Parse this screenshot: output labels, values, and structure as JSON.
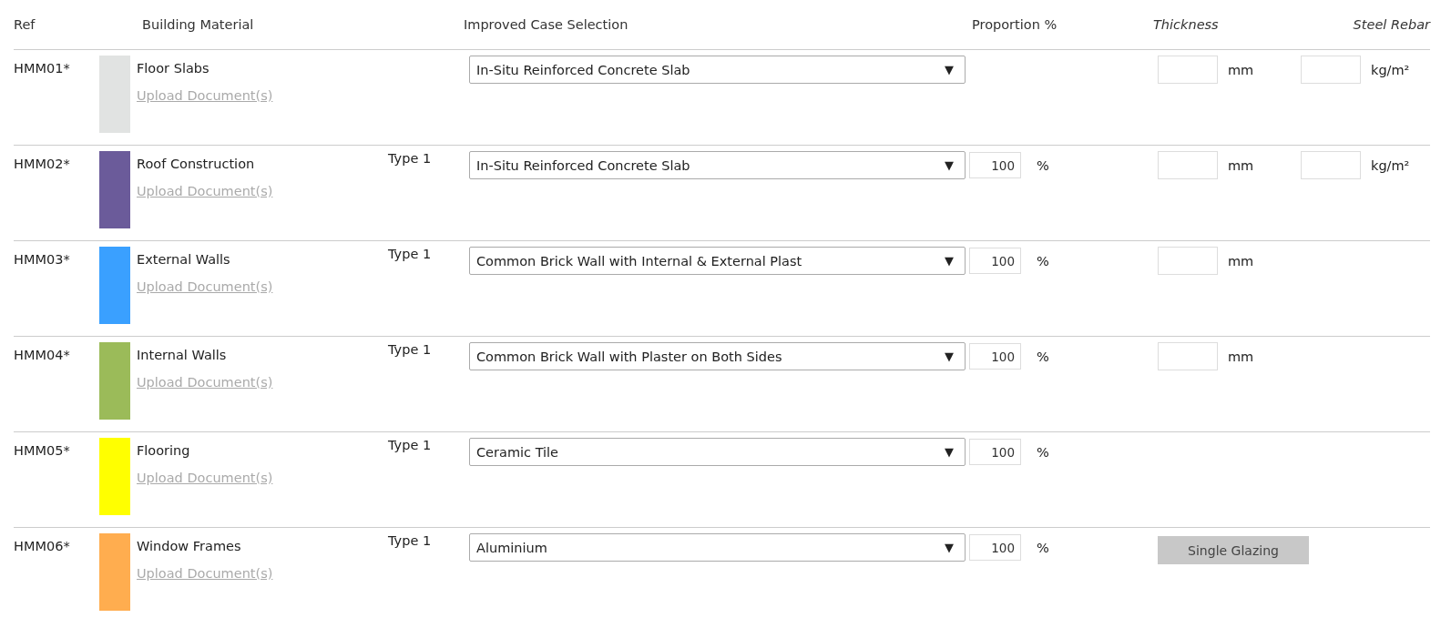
{
  "columns": {
    "ref": "Ref",
    "material": "Building Material",
    "selection": "Improved Case Selection",
    "proportion": "Proportion %",
    "thickness": "Thickness",
    "rebar": "Steel Rebar"
  },
  "rows": [
    {
      "ref": "HMM01*",
      "color": "#e1e3e2",
      "name": "Floor Slabs",
      "upload": "Upload Document(s)",
      "selection": "In-Situ Reinforced Concrete Slab",
      "arrow": "▼",
      "thickness_unit": "mm",
      "rebar_unit": "kg/m²"
    },
    {
      "ref": "HMM02*",
      "color": "#6b5b9a",
      "name": "Roof Construction",
      "upload": "Upload Document(s)",
      "type": "Type 1",
      "selection": "In-Situ Reinforced Concrete Slab",
      "arrow": "▼",
      "proportion": "100",
      "proportion_unit": "%",
      "thickness_unit": "mm",
      "rebar_unit": "kg/m²"
    },
    {
      "ref": "HMM03*",
      "color": "#3aa0ff",
      "name": "External Walls",
      "upload": "Upload Document(s)",
      "type": "Type 1",
      "selection": "Common Brick Wall with Internal & External Plast",
      "arrow": "▼",
      "proportion": "100",
      "proportion_unit": "%",
      "thickness_unit": "mm"
    },
    {
      "ref": "HMM04*",
      "color": "#9bbb59",
      "name": "Internal Walls",
      "upload": "Upload Document(s)",
      "type": "Type 1",
      "selection": "Common Brick Wall with Plaster on Both Sides",
      "arrow": "▼",
      "proportion": "100",
      "proportion_unit": "%",
      "thickness_unit": "mm"
    },
    {
      "ref": "HMM05*",
      "color": "#ffff00",
      "name": "Flooring",
      "upload": "Upload Document(s)",
      "type": "Type 1",
      "selection": "Ceramic Tile",
      "arrow": "▼",
      "proportion": "100",
      "proportion_unit": "%"
    },
    {
      "ref": "HMM06*",
      "color": "#ffad4f",
      "name": "Window Frames",
      "upload": "Upload Document(s)",
      "type": "Type 1",
      "selection": "Aluminium",
      "arrow": "▼",
      "proportion": "100",
      "proportion_unit": "%",
      "glazing_button": "Single Glazing"
    }
  ]
}
